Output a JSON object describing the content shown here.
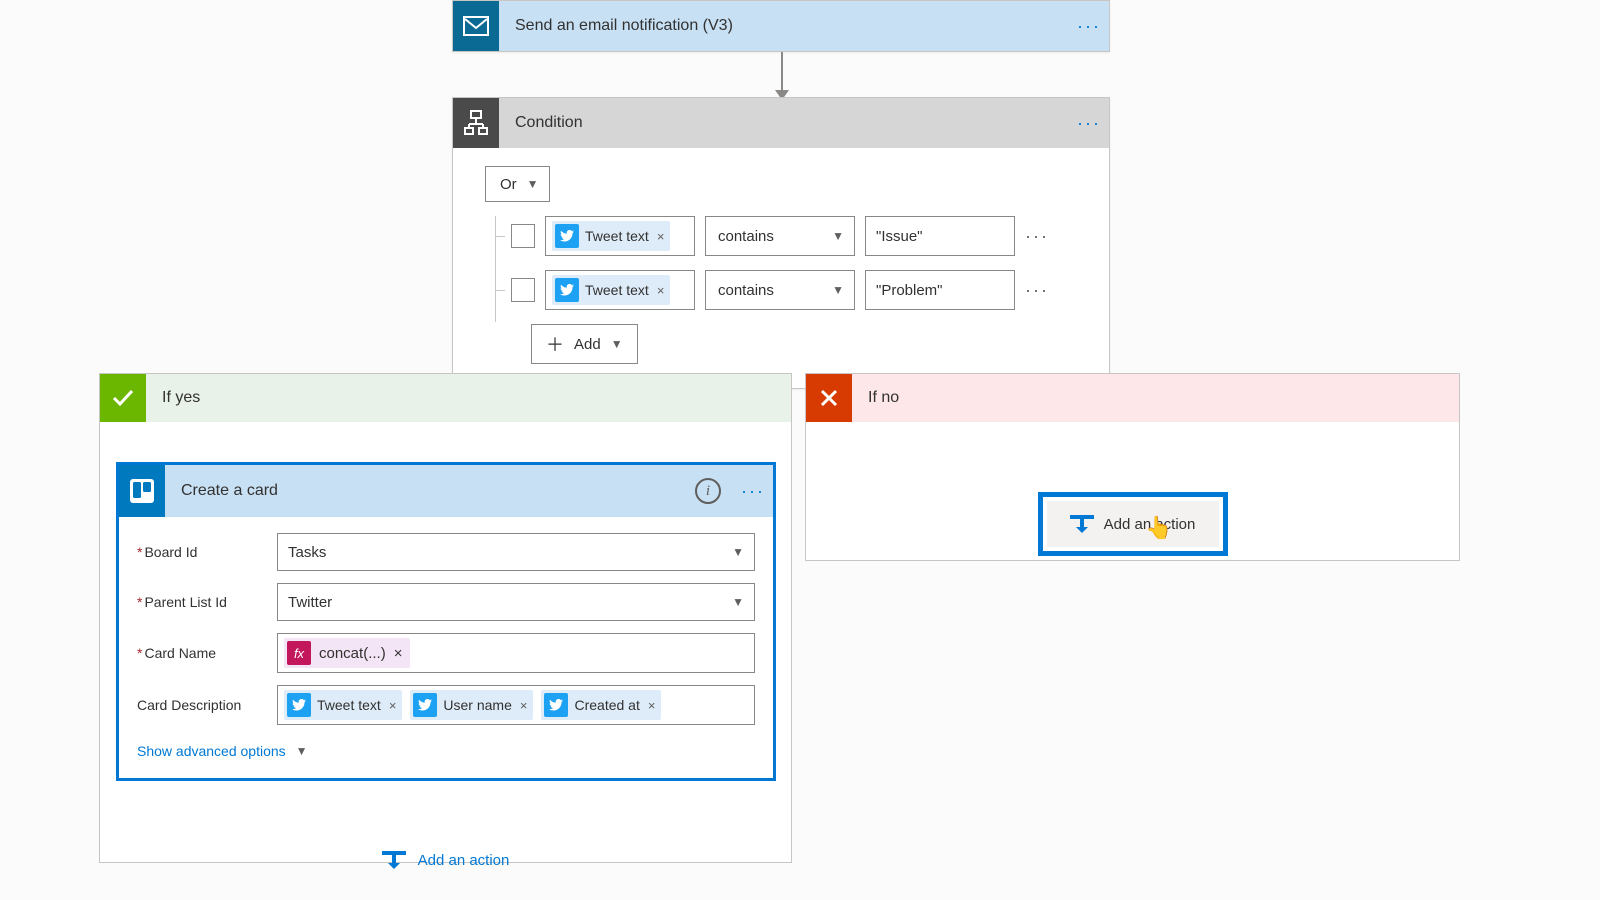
{
  "steps": {
    "email": {
      "title": "Send an email notification (V3)"
    },
    "condition": {
      "title": "Condition",
      "logic_operator": "Or",
      "rows": [
        {
          "field_token": "Tweet text",
          "operator": "contains",
          "value": "\"Issue\""
        },
        {
          "field_token": "Tweet text",
          "operator": "contains",
          "value": "\"Problem\""
        }
      ],
      "add_label": "Add"
    }
  },
  "branches": {
    "yes": {
      "title": "If yes",
      "action": {
        "title": "Create a card",
        "fields": {
          "board_id": {
            "label": "Board Id",
            "required": true,
            "value": "Tasks",
            "type": "select"
          },
          "parent_list": {
            "label": "Parent List Id",
            "required": true,
            "value": "Twitter",
            "type": "select"
          },
          "card_name": {
            "label": "Card Name",
            "required": true,
            "tokens": [
              {
                "kind": "fx",
                "text": "concat(...)"
              }
            ]
          },
          "card_desc": {
            "label": "Card Description",
            "required": false,
            "tokens": [
              {
                "kind": "twitter",
                "text": "Tweet text"
              },
              {
                "kind": "twitter",
                "text": "User name"
              },
              {
                "kind": "twitter",
                "text": "Created at"
              }
            ]
          }
        },
        "advanced_label": "Show advanced options"
      },
      "add_action_label": "Add an action"
    },
    "no": {
      "title": "If no",
      "add_action_label": "Add an action"
    }
  }
}
